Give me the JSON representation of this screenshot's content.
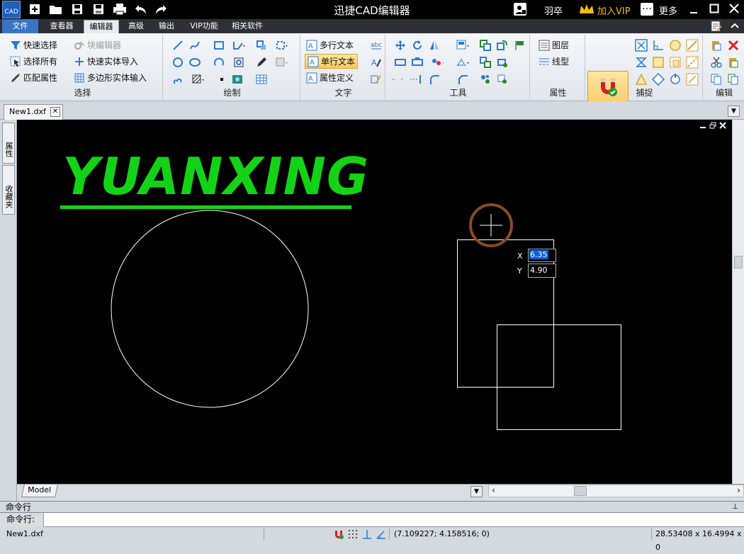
{
  "app": {
    "title": "迅捷CAD编辑器",
    "logo_text": "CAD",
    "user": "羽卒",
    "vip_label": "加入VIP",
    "more_label": "更多",
    "quick_icons": [
      "new-icon",
      "open-icon",
      "save-icon",
      "save-as-icon",
      "print-icon",
      "undo-icon",
      "redo-icon"
    ]
  },
  "menu": {
    "tabs": [
      "文件",
      "查看器",
      "编辑器",
      "高级",
      "输出",
      "VIP功能",
      "相关软件"
    ],
    "active": "编辑器"
  },
  "ribbon": {
    "select": {
      "label": "选择",
      "quick_select": "快速选择",
      "select_all": "选择所有",
      "match_props": "匹配属性",
      "block_editor": "块编辑器",
      "quick_entity_import": "快速实体导入",
      "polygon_entity_input": "多边形实体输入"
    },
    "draw": {
      "label": "绘制"
    },
    "text": {
      "label": "文字",
      "mtext": "多行文本",
      "stext": "单行文本",
      "attdef": "属性定义"
    },
    "tools": {
      "label": "工具"
    },
    "props": {
      "label": "属性",
      "layer": "图层",
      "linetype": "线型"
    },
    "snap": {
      "label": "捕捉",
      "button": "捕捉"
    },
    "edit": {
      "label": "编辑"
    }
  },
  "document": {
    "tab_name": "New1.dxf",
    "model_tab": "Model"
  },
  "canvas": {
    "title_text": "YUANXING",
    "title_color": "#12d316",
    "input_x_label": "X",
    "input_x_value": "6.35",
    "input_y_label": "Y",
    "input_y_value": "4.90"
  },
  "side_tabs": [
    "属性",
    "收藏夹"
  ],
  "command": {
    "header": "命令行",
    "prompt": "命令行:",
    "value": ""
  },
  "status": {
    "file": "New1.dxf",
    "coords": "(7.109227; 4.158516; 0)",
    "size": "28.53408 x 16.4994 x 0"
  }
}
